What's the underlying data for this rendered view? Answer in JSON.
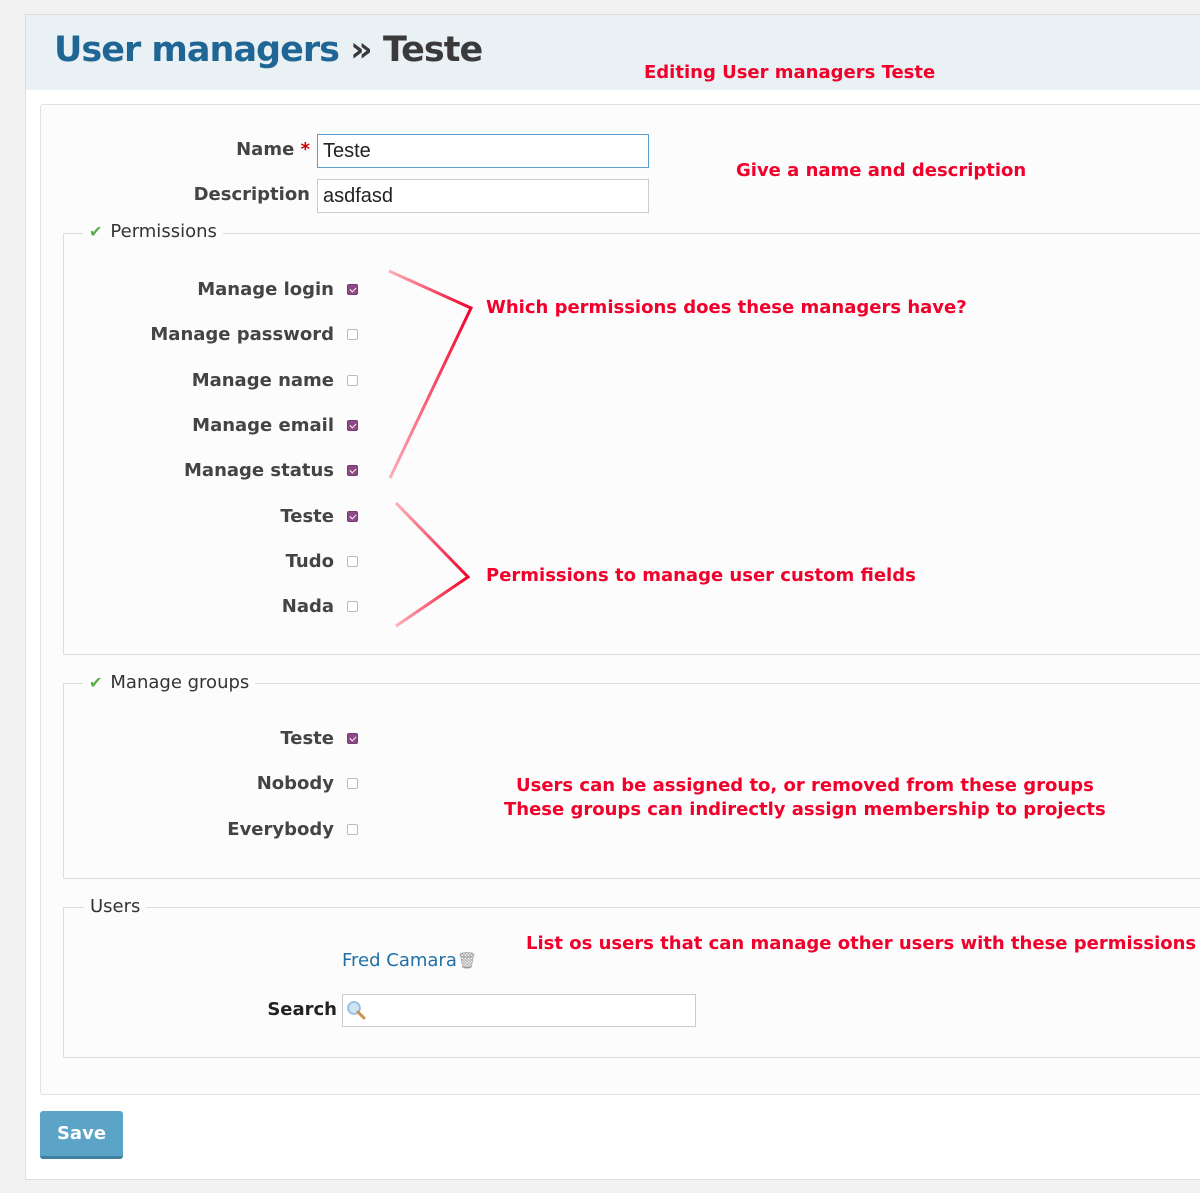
{
  "header": {
    "breadcrumb": "User managers",
    "separator": "»",
    "current": "Teste"
  },
  "form": {
    "name_label": "Name",
    "required_mark": "*",
    "name_value": "Teste",
    "description_label": "Description",
    "description_value": "asdfasd"
  },
  "permissions": {
    "legend": "Permissions",
    "items": [
      {
        "label": "Manage login",
        "checked": true
      },
      {
        "label": "Manage password",
        "checked": false
      },
      {
        "label": "Manage name",
        "checked": false
      },
      {
        "label": "Manage email",
        "checked": true
      },
      {
        "label": "Manage status",
        "checked": true
      },
      {
        "label": "Teste",
        "checked": true
      },
      {
        "label": "Tudo",
        "checked": false
      },
      {
        "label": "Nada",
        "checked": false
      }
    ]
  },
  "groups": {
    "legend": "Manage groups",
    "items": [
      {
        "label": "Teste",
        "checked": true
      },
      {
        "label": "Nobody",
        "checked": false
      },
      {
        "label": "Everybody",
        "checked": false
      }
    ]
  },
  "users": {
    "legend": "Users",
    "list": [
      "Fred Camara"
    ],
    "search_label": "Search",
    "search_value": ""
  },
  "save_label": "Save",
  "annotations": {
    "editing": "Editing User managers Teste",
    "name_desc": "Give a name and description",
    "permissions": "Which permissions does these managers have?",
    "custom_fields": "Permissions to manage user custom fields",
    "groups_1": "Users can be assigned to, or removed from these groups",
    "groups_2": "These groups can indirectly assign membership to projects",
    "users": "List os users that can manage other users with these permissions"
  },
  "colors": {
    "annotation": "#f0002a",
    "link": "#1f6fa6",
    "checkbox": "#8e4a86",
    "save": "#5ba4c7"
  }
}
